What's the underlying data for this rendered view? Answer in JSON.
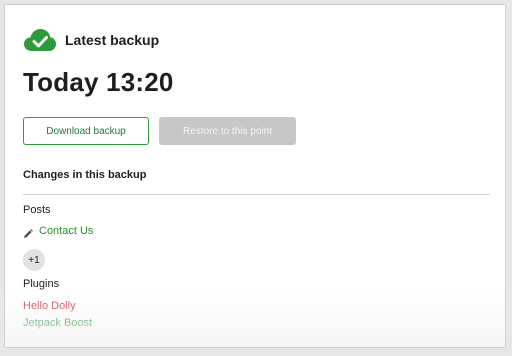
{
  "header": {
    "title": "Latest backup",
    "status_icon": "cloud-check-icon",
    "status_color": "#2d9a3b"
  },
  "backup": {
    "timestamp": "Today 13:20"
  },
  "actions": {
    "download_label": "Download backup",
    "restore_label": "Restore to this point",
    "restore_disabled": true
  },
  "changes": {
    "title": "Changes in this backup",
    "posts": {
      "label": "Posts",
      "items": [
        {
          "label": "Contact Us",
          "icon": "pencil-icon",
          "color": "#2a8f2e"
        }
      ],
      "more_count": "+1"
    },
    "plugins": {
      "label": "Plugins",
      "items": [
        {
          "label": "Hello Dolly",
          "color": "#c8373a"
        },
        {
          "label": "Jetpack Boost",
          "color": "#2a8f2e"
        }
      ]
    }
  }
}
